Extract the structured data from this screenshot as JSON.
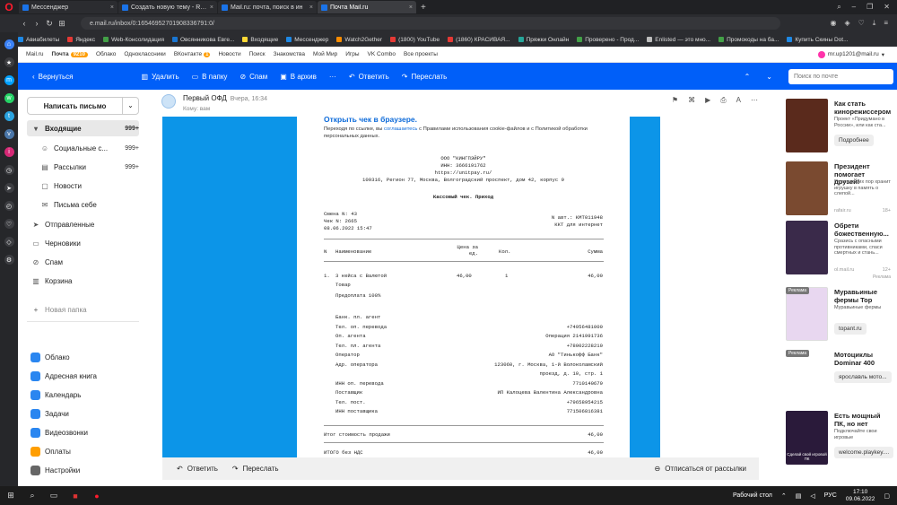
{
  "browser": {
    "tabs": [
      {
        "label": "Мессенджер",
        "active": false
      },
      {
        "label": "Создать новую тему - Ren",
        "active": false
      },
      {
        "label": "Mail.ru: почта, поиск в ин",
        "active": false
      },
      {
        "label": "Почта Mail.ru",
        "active": true
      }
    ],
    "address": "e.mail.ru/inbox/0:16546952701908336791:0/",
    "bookmarks": [
      "Авиабилеты",
      "Яндекс",
      "Web-Консолидация",
      "Овсянникова Евге...",
      "Входящие",
      "Мессенджер",
      "Watch2Gether",
      "(1800) YouTube",
      "(1860) КРАСИВАЯ...",
      "Пряжки Онлайн",
      "Проверено - Прод...",
      "Enlisted — это мно...",
      "Промокоды на ба...",
      "Купить Скины Dot..."
    ]
  },
  "portal": {
    "links": [
      {
        "label": "Mail.ru"
      },
      {
        "label": "Почта",
        "badge": "9210",
        "active": true
      },
      {
        "label": "Облако"
      },
      {
        "label": "Одноклассники"
      },
      {
        "label": "ВКонтакте",
        "badge": "1"
      },
      {
        "label": "Новости"
      },
      {
        "label": "Поиск"
      },
      {
        "label": "Знакомства"
      },
      {
        "label": "Мой Мир"
      },
      {
        "label": "Игры"
      },
      {
        "label": "VK Combo"
      },
      {
        "label": "Все проекты"
      }
    ],
    "user": "mr.up1201@mail.ru"
  },
  "toolbar": {
    "back": "Вернуться",
    "delete": "Удалить",
    "to_folder": "В папку",
    "spam": "Спам",
    "archive": "В архив",
    "more": "···",
    "reply": "Ответить",
    "forward": "Переслать",
    "search_placeholder": "Поиск по почте"
  },
  "sidebar": {
    "compose": "Написать письмо",
    "folders": [
      {
        "label": "Входящие",
        "count": "999+",
        "icon": "inbox-icon",
        "active": true,
        "sub": false,
        "glyph": "▾"
      },
      {
        "label": "Социальные с...",
        "count": "999+",
        "icon": "social-icon",
        "sub": true,
        "glyph": "☺"
      },
      {
        "label": "Рассылки",
        "count": "999+",
        "icon": "newsletter-icon",
        "sub": true,
        "glyph": "▤"
      },
      {
        "label": "Новости",
        "count": "",
        "icon": "news-icon",
        "sub": true,
        "glyph": "▢"
      },
      {
        "label": "Письма себе",
        "count": "",
        "icon": "self-icon",
        "sub": true,
        "glyph": "✉"
      },
      {
        "label": "Отправленные",
        "count": "",
        "icon": "sent-icon",
        "sub": false,
        "glyph": "➤"
      },
      {
        "label": "Черновики",
        "count": "",
        "icon": "drafts-icon",
        "sub": false,
        "glyph": "▭"
      },
      {
        "label": "Спам",
        "count": "",
        "icon": "spam-icon",
        "sub": false,
        "glyph": "⊘"
      },
      {
        "label": "Корзина",
        "count": "",
        "icon": "trash-icon",
        "sub": false,
        "glyph": "▥"
      }
    ],
    "new_folder": "Новая папка",
    "apps": [
      {
        "label": "Облако",
        "color": "#2a86f0"
      },
      {
        "label": "Адресная книга",
        "color": "#2a86f0"
      },
      {
        "label": "Календарь",
        "color": "#2a86f0"
      },
      {
        "label": "Задачи",
        "color": "#2a86f0"
      },
      {
        "label": "Видеозвонки",
        "color": "#2a86f0"
      },
      {
        "label": "Оплаты",
        "color": "#ff9e00"
      },
      {
        "label": "Настройки",
        "color": "#666666"
      }
    ]
  },
  "message": {
    "sender": "Первый ОФД",
    "date": "Вчера, 16:34",
    "to": "Кому: вам",
    "open_link": "Открыть чек в браузере.",
    "cookie_prefix": "Переходя по ссылке, вы",
    "cookie_link": "соглашаетесь",
    "cookie_suffix": "с Правилами использования cookie-файлов и с Политикой обработки персональных данных.",
    "receipt": {
      "org": "ООО \"КИНГПЭЙРУ\"",
      "inn": "ИНН: 3666191762",
      "site": "https://unitpay.ru/",
      "address": "109316, Регион 77, Москва, Волгоградский проспект, дом 42, корпус 9",
      "title": "Кассовый чек. Приход",
      "shift": "Смена N: 43",
      "check": "Чек N: 2665",
      "datetime": "08.06.2022 15:47",
      "auto": "N авт.: КМТ011948",
      "kkt": "ККТ для интернет",
      "col_n": "N",
      "col_name": "Наименование",
      "col_price": "Цена за ед.",
      "col_qty": "Кол.",
      "col_sum": "Сумма",
      "item_n": "1.",
      "item_name": "3 кейса с Валютой",
      "item_price": "46,00",
      "item_qty": "1",
      "item_sum": "46,00",
      "item_type": "Товар",
      "item_prepay": "Предоплата 100%",
      "agent_rows": [
        {
          "k": "Банк. пл. агент",
          "v": ""
        },
        {
          "k": "Тел. оп. перевода",
          "v": "+74956481000"
        },
        {
          "k": "Оп. агента",
          "v": "Операция 2141991736"
        },
        {
          "k": "Тел. пл. агента",
          "v": "+78002228210"
        },
        {
          "k": "Оператор",
          "v": "АО \"Тинькофф Банк\""
        },
        {
          "k": "Адр. оператора",
          "v": "123060, г. Москва, 1-й Волоколамский"
        },
        {
          "k": "",
          "v": "проезд, д. 10, стр. 1"
        },
        {
          "k": "ИНН оп. перевода",
          "v": "7710140679"
        },
        {
          "k": "Поставщик",
          "v": "ИП Калоцева Валентина Александровна"
        },
        {
          "k": "Тел. пост.",
          "v": "+79658954215"
        },
        {
          "k": "ИНН поставщика",
          "v": "771506816381"
        }
      ],
      "total_label": "Итог стоимость продажи",
      "total_value": "46,00",
      "vat_label": "ИТОГО без НДС",
      "vat_value": "46,00"
    },
    "footer": {
      "reply": "Ответить",
      "forward": "Переслать",
      "unsubscribe": "Отписаться от рассылки"
    }
  },
  "ads": {
    "items": [
      {
        "title": "Как стать кинорежиссером",
        "desc": "Проект «Придумано в России», или как ста...",
        "button": "Подробнее",
        "source": "",
        "count": "",
        "badge": "",
        "color": "#5a2a1c"
      },
      {
        "title": "Президент помогает друзей!",
        "desc": "Путин до сих пор хранит игрушку в память о слепой...",
        "button": "",
        "source": "rafair.ru",
        "count": "18+",
        "badge": "",
        "color": "#7a4a30"
      },
      {
        "title": "Обрети божественную...",
        "desc": "Сразись с опасными противниками, спаси смертных и стань...",
        "button": "",
        "source": "ol.mail.ru",
        "count": "12+",
        "badge": "",
        "color": "#3a2a4a"
      },
      {
        "title": "Муравьиные фермы Top",
        "desc": "Муравьиные фермы",
        "button": "topant.ru",
        "source": "",
        "count": "",
        "badge": "Реклама",
        "color": "#e8d7f0"
      },
      {
        "title": "Мотоциклы Dominar 400",
        "desc": "",
        "button": "ярославль мото...",
        "source": "",
        "count": "",
        "badge": "Реклама",
        "color": "#ffffff"
      },
      {
        "title": "Есть мощный ПК, но нет",
        "desc": "Подключайте свои игровые",
        "button": "welcome.playkey....",
        "source": "",
        "count": "",
        "badge": "",
        "color": "#2a1a3a"
      }
    ],
    "ads_label": "Реклама",
    "pc_caption": "Сделай свой игровой ПК"
  },
  "taskbar": {
    "desktop": "Рабочий стол",
    "lang": "РУС",
    "time": "17:10",
    "date": "09.06.2022"
  }
}
